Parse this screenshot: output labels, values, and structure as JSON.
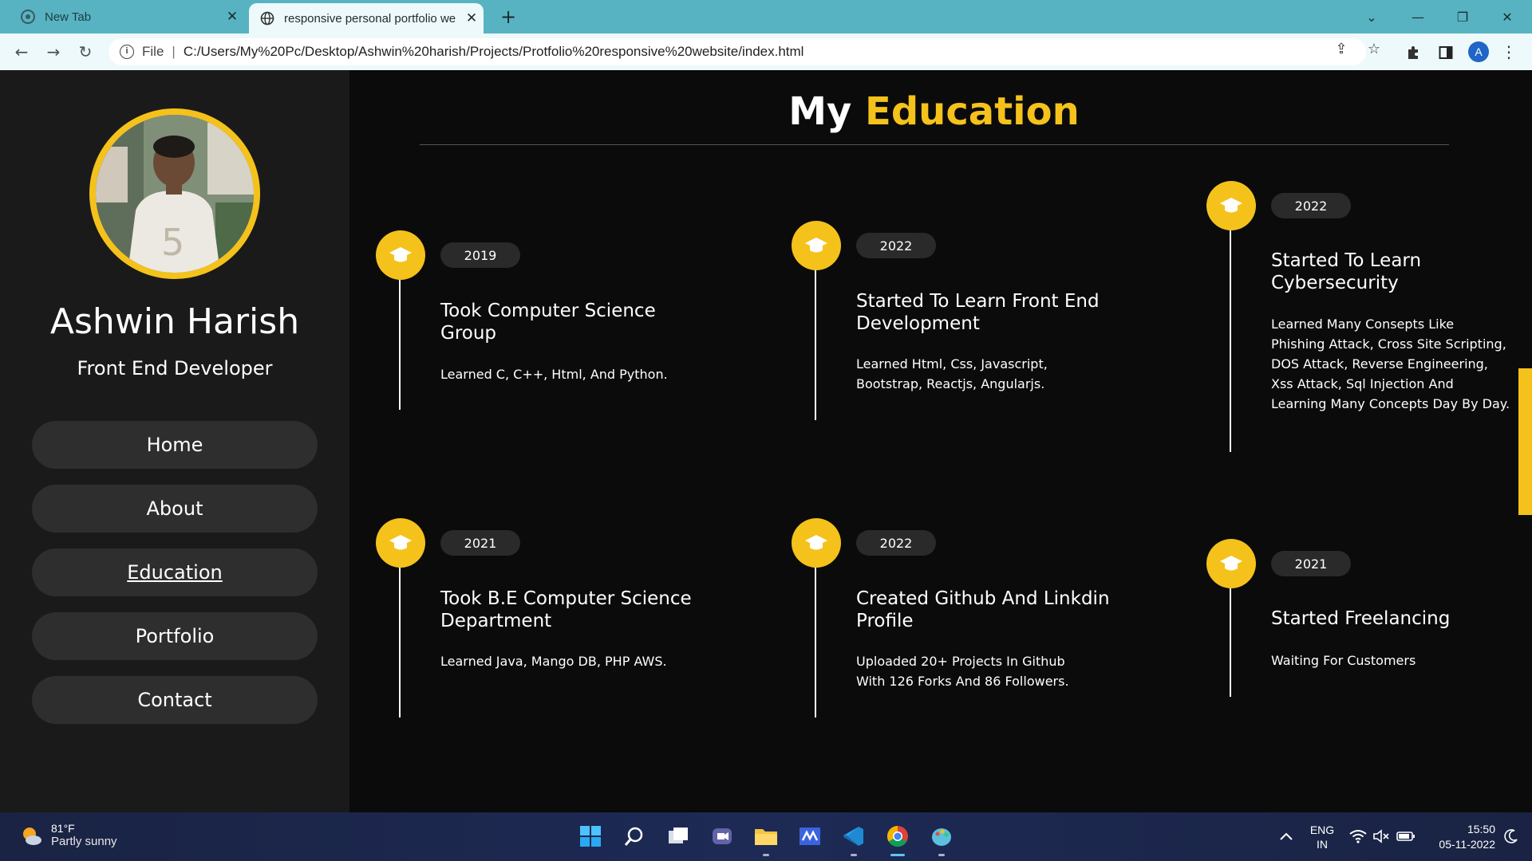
{
  "browser": {
    "tabs": [
      {
        "title": "New Tab",
        "active": false
      },
      {
        "title": "responsive personal portfolio we",
        "active": true
      }
    ],
    "address": {
      "scheme": "File",
      "url": "C:/Users/My%20Pc/Desktop/Ashwin%20harish/Projects/Protfolio%20responsive%20website/index.html"
    },
    "profile_initial": "A",
    "colors": {
      "tabbar": "#57b3c2",
      "toolbar": "#eef9fb",
      "accent": "#f4c21b"
    }
  },
  "sidebar": {
    "name": "Ashwin Harish",
    "role": "Front End Developer",
    "nav": [
      {
        "label": "Home"
      },
      {
        "label": "About"
      },
      {
        "label": "Education",
        "current": true
      },
      {
        "label": "Portfolio"
      },
      {
        "label": "Contact"
      }
    ]
  },
  "education": {
    "heading_prefix": "My",
    "heading_accent": "Education",
    "entries": [
      {
        "year": "2019",
        "title": "Took Computer Science Group",
        "description": "Learned C, C++, Html, And Python.",
        "icon": "graduation-cap-icon"
      },
      {
        "year": "2022",
        "title": "Started To Learn Front End Development",
        "description": "Learned Html, Css, Javascript, Bootstrap, Reactjs, Angularjs.",
        "icon": "graduation-cap-icon"
      },
      {
        "year": "2022",
        "title": "Started To Learn Cybersecurity",
        "description": "Learned Many Consepts Like Phishing Attack, Cross Site Scripting, DOS Attack, Reverse Engineering, Xss Attack, Sql Injection And Learning Many Concepts Day By Day.",
        "icon": "graduation-cap-icon"
      },
      {
        "year": "2021",
        "title": "Took B.E Computer Science Department",
        "description": "Learned Java, Mango DB, PHP AWS.",
        "icon": "graduation-cap-icon"
      },
      {
        "year": "2022",
        "title": "Created Github And Linkdin Profile",
        "description": "Uploaded 20+ Projects In Github With 126 Forks And 86 Followers.",
        "icon": "graduation-cap-icon"
      },
      {
        "year": "2021",
        "title": "Started Freelancing",
        "description": "Waiting For Customers",
        "icon": "graduation-cap-icon"
      }
    ]
  },
  "taskbar": {
    "weather": {
      "temp": "81°F",
      "condition": "Partly sunny"
    },
    "language": {
      "line1": "ENG",
      "line2": "IN"
    },
    "clock": {
      "time": "15:50",
      "date": "05-11-2022"
    }
  }
}
